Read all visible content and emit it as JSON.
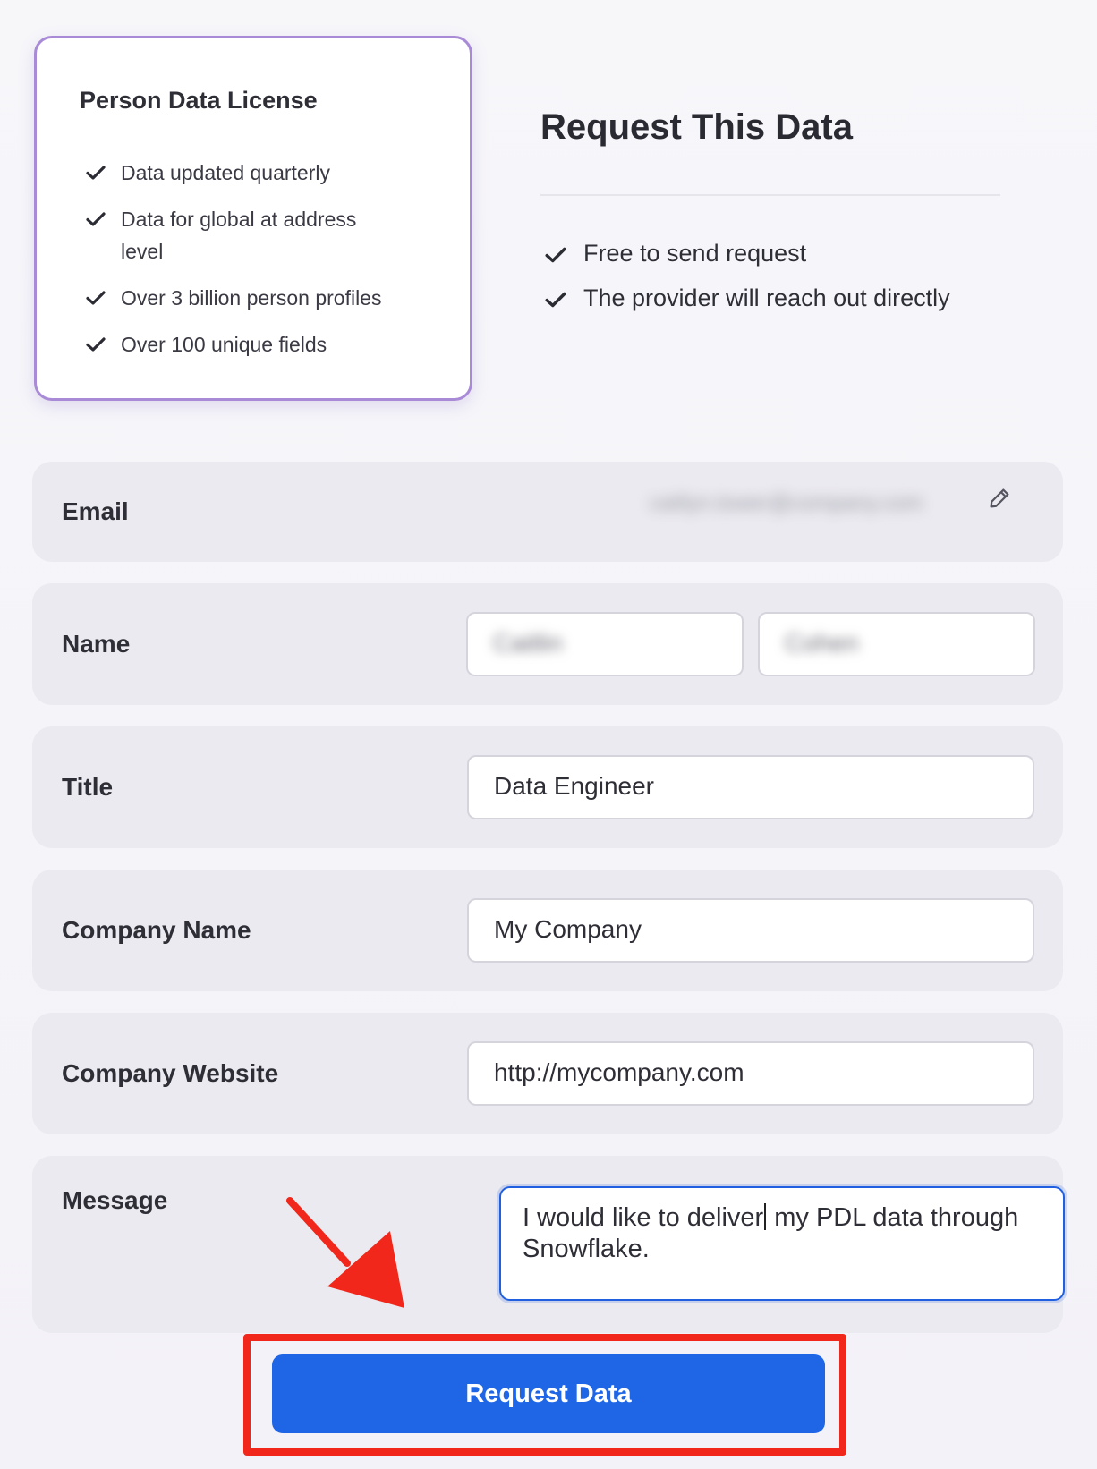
{
  "license": {
    "title": "Person Data License",
    "features": [
      "Data updated quarterly",
      "Data for global at address level",
      "Over 3 billion person profiles",
      "Over 100 unique fields"
    ]
  },
  "request": {
    "title": "Request This Data",
    "benefits": [
      "Free to send request",
      "The provider will reach out directly"
    ]
  },
  "form": {
    "email": {
      "label": "Email",
      "value": "caitlyn.tower@company.com",
      "edit_icon": "pencil-icon"
    },
    "name": {
      "label": "Name",
      "first": "Caitlin",
      "last": "Cohen"
    },
    "title": {
      "label": "Title",
      "value": "Data Engineer"
    },
    "company_name": {
      "label": "Company Name",
      "value": "My Company"
    },
    "company_website": {
      "label": "Company Website",
      "value": "http://mycompany.com"
    },
    "message": {
      "label": "Message",
      "value_before_caret": "I would like to deliver",
      "value_after_caret": " my PDL data through Snowflake."
    }
  },
  "submit": {
    "label": "Request Data"
  },
  "colors": {
    "accent": "#1e66e6",
    "card_border": "#a98ad6",
    "annotation": "#f0271a"
  }
}
